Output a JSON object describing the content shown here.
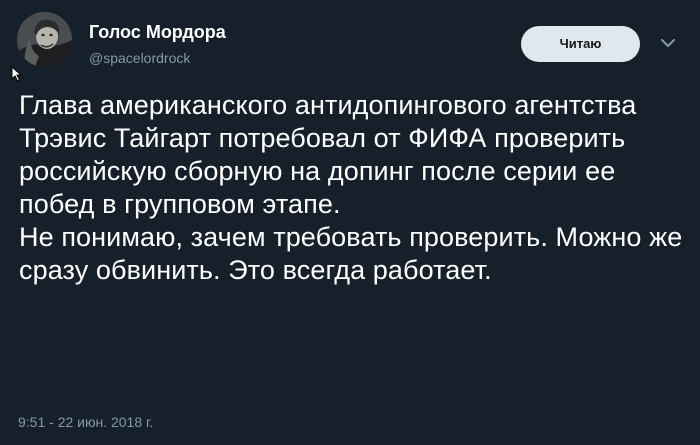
{
  "author": {
    "name": "Голос Мордора",
    "handle": "@spacelordrock",
    "avatar_icon": "user-avatar"
  },
  "follow_button": {
    "label": "Читаю"
  },
  "menu_icon": "chevron-down-icon",
  "tweet": {
    "paragraphs": [
      "Глава американского антидопингового агентства Трэвис Тайгарт потребовал от ФИФА проверить российскую сборную на допинг после серии ее побед в групповом этапе.",
      "Не понимаю, зачем требовать проверить. Можно же сразу обвинить. Это всегда работает."
    ]
  },
  "timestamp": "9:51 - 22 июн. 2018 г.",
  "colors": {
    "background": "#15202b",
    "text_primary": "#ffffff",
    "text_secondary": "#8899a6",
    "button_bg": "#e1e8ed"
  }
}
